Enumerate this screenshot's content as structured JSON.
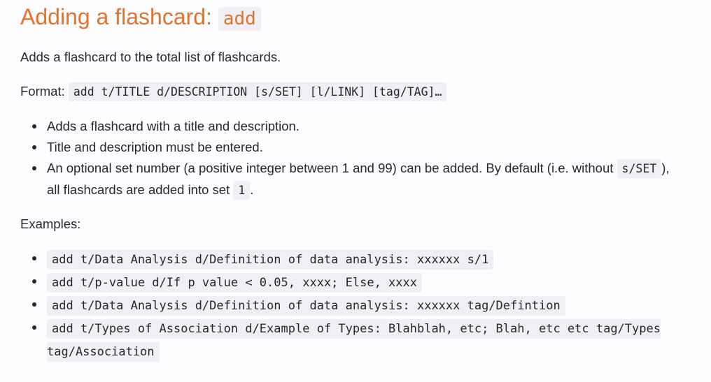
{
  "heading": {
    "text": "Adding a flashcard: ",
    "code": "add"
  },
  "description": "Adds a flashcard to the total list of flashcards.",
  "format": {
    "label": "Format: ",
    "code": "add t/TITLE d/DESCRIPTION [s/SET] [l/LINK] [tag/TAG]…"
  },
  "notes": {
    "item1": "Adds a flashcard with a title and description.",
    "item2": "Title and description must be entered.",
    "item3": {
      "text_a": "An optional set number (a positive integer between 1 and 99) can be added. By default (i.e. without ",
      "code_a": "s/SET",
      "text_b": "), all flashcards are added into set ",
      "code_b": "1",
      "text_c": "."
    }
  },
  "examples": {
    "label": "Examples:",
    "items": [
      "add t/Data Analysis d/Definition of data analysis: xxxxxx s/1",
      "add t/p-value d/If p value < 0.05, xxxx; Else, xxxx",
      "add t/Data Analysis d/Definition of data analysis: xxxxxx tag/Defintion",
      "add t/Types of Association d/Example of Types: Blahblah, etc; Blah, etc etc tag/Types tag/Association"
    ]
  }
}
